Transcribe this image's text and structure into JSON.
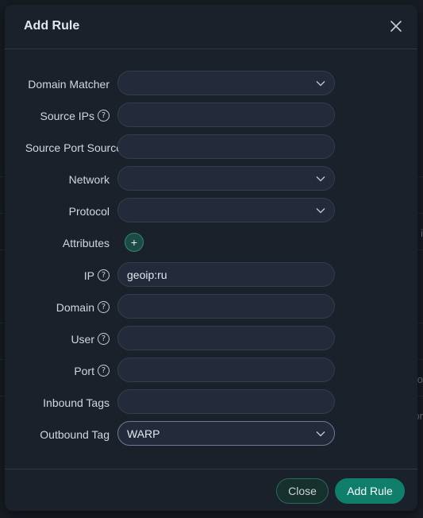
{
  "modal": {
    "title": "Add Rule",
    "close_label": "Close",
    "submit_label": "Add Rule"
  },
  "background": {
    "fragments": [
      "i",
      "o",
      "or"
    ]
  },
  "form": {
    "domain_matcher": {
      "label": "Domain Matcher",
      "value": ""
    },
    "source_ips": {
      "label": "Source IPs",
      "value": ""
    },
    "source_port": {
      "label": "Source Port Source",
      "value": ""
    },
    "network": {
      "label": "Network",
      "value": ""
    },
    "protocol": {
      "label": "Protocol",
      "value": ""
    },
    "attributes": {
      "label": "Attributes",
      "add_symbol": "+"
    },
    "ip": {
      "label": "IP",
      "value": "geoip:ru"
    },
    "domain": {
      "label": "Domain",
      "value": ""
    },
    "user": {
      "label": "User",
      "value": ""
    },
    "port": {
      "label": "Port",
      "value": ""
    },
    "inbound_tags": {
      "label": "Inbound Tags",
      "value": ""
    },
    "outbound_tag": {
      "label": "Outbound Tag",
      "value": "WARP"
    },
    "help_symbol": "?"
  },
  "colors": {
    "accent": "#0f7f6c",
    "modal_bg": "#1b212b",
    "field_bg": "#232b3b"
  },
  "icons": [
    "close-icon",
    "chevron-down-icon",
    "help-icon",
    "plus-icon"
  ]
}
